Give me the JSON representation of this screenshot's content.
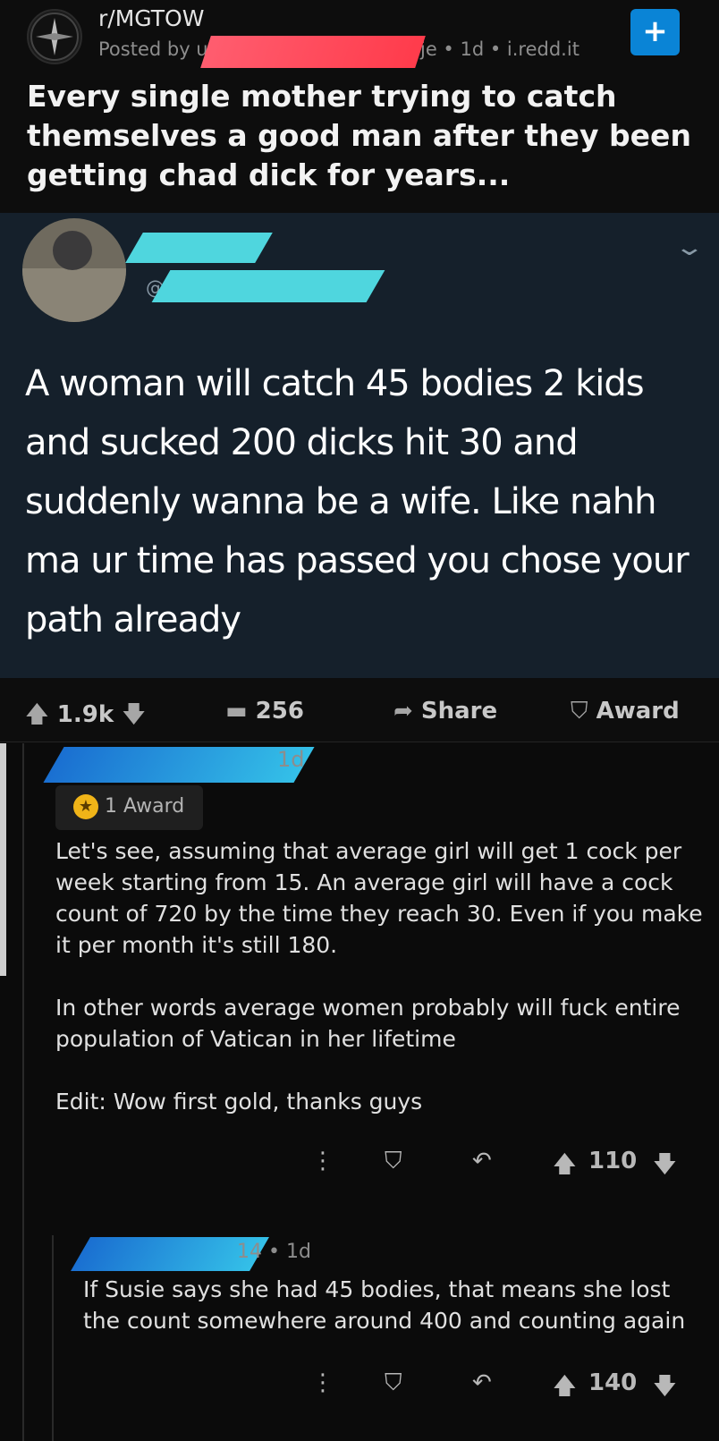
{
  "post": {
    "subreddit": "r/MGTOW",
    "posted_by_prefix": "Posted by u",
    "meta": "je • 1d • i.redd.it",
    "join_icon": "+",
    "title": "Every single mother trying to catch themselves a good man after they been getting chad dick for years..."
  },
  "tweet": {
    "handle_prefix": "@",
    "chevron_icon": "chevron-down",
    "text": "A woman will catch 45 bodies 2 kids and sucked 200 dicks hit 30 and suddenly wanna be a wife. Like nahh ma ur time has passed you chose your path already"
  },
  "actions": {
    "upvotes": "1.9k",
    "comments": "256",
    "share": "Share",
    "award": "Award"
  },
  "comments": [
    {
      "age": "1d",
      "award_label": "1 Award",
      "paragraphs": [
        "Let's see, assuming that average girl will get 1 cock per week starting from 15. An average girl will have a cock count of 720 by the time they reach 30. Even if you make it per month it's still 180.",
        "In other words average women probably will fuck entire population of Vatican in her lifetime",
        "Edit: Wow first gold, thanks guys"
      ],
      "votes": "110"
    },
    {
      "meta": "14 • 1d",
      "body": "If Susie says she had 45 bodies, that means she lost the count somewhere around 400 and counting again",
      "votes": "140"
    }
  ],
  "colors": {
    "join_button": "#0a84d6",
    "tweet_bg": "#15202b",
    "award_gold": "#f0b418"
  }
}
